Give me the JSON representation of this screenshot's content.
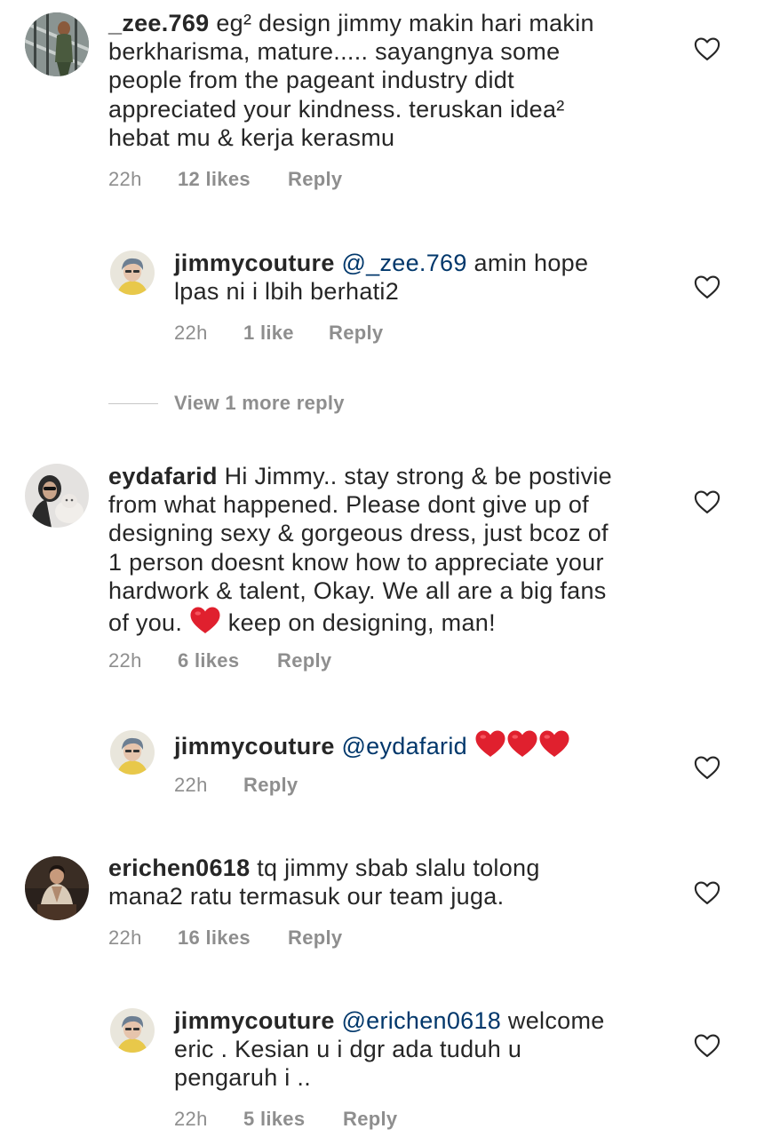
{
  "comments": [
    {
      "username": "_zee.769",
      "text": "eg² design jimmy makin hari makin berkharisma, mature..... sayangnya some people from the pageant industry didt appreciated your kindness.  teruskan idea² hebat mu & kerja kerasmu",
      "lines": [
        "eg² design jimmy makin hari makin",
        "berkharisma, mature..... sayangnya some",
        "people from the pageant industry didt",
        "appreciated your kindness.  teruskan idea²",
        "hebat mu & kerja kerasmu"
      ],
      "time": "22h",
      "likes": "12 likes",
      "reply": "Reply"
    },
    {
      "username": "jimmycouture",
      "mention": "@_zee.769",
      "lines": [
        "amin hope",
        "lpas ni i lbih berhati2"
      ],
      "time": "22h",
      "likes": "1 like",
      "reply": "Reply"
    },
    {
      "username": "eydafarid",
      "lines": [
        "Hi Jimmy.. stay strong & be postivie",
        "from what happened. Please dont give up of",
        "designing sexy & gorgeous dress, just bcoz of",
        "1 person doesnt know how to appreciate your",
        "hardwork & talent, Okay. We all are a big fans",
        "of you.",
        "keep on designing, man!"
      ],
      "time": "22h",
      "likes": "6 likes",
      "reply": "Reply"
    },
    {
      "username": "jimmycouture",
      "mention": "@eydafarid",
      "time": "22h",
      "reply": "Reply"
    },
    {
      "username": "erichen0618",
      "lines": [
        "tq jimmy sbab slalu tolong",
        "mana2 ratu termasuk our team juga."
      ],
      "time": "22h",
      "likes": "16 likes",
      "reply": "Reply"
    },
    {
      "username": "jimmycouture",
      "mention": "@erichen0618",
      "lines": [
        "welcome",
        "eric . Kesian u i dgr ada tuduh u",
        "pengaruh i .."
      ],
      "time": "22h",
      "likes": "5 likes",
      "reply": "Reply"
    }
  ],
  "view_more": "View 1 more reply",
  "colors": {
    "text": "#262626",
    "secondary": "#8e8e8e",
    "mention": "#00376b",
    "heart_emoji": "#e0202e"
  },
  "icons": {
    "like": "heart-outline-icon",
    "emoji": "red-heart-emoji"
  }
}
